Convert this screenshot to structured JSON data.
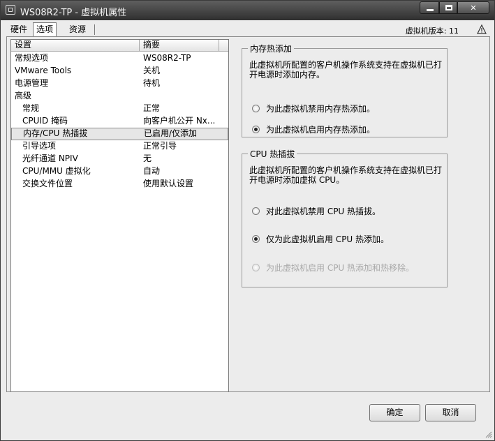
{
  "window": {
    "title": "WS08R2-TP - 虚拟机属性"
  },
  "tabs": [
    {
      "label": "硬件"
    },
    {
      "label": "选项"
    },
    {
      "label": "资源"
    }
  ],
  "version_label": "虚拟机版本: 11",
  "list": {
    "headers": {
      "setting": "设置",
      "summary": "摘要"
    },
    "rows": [
      {
        "name": "常规选项",
        "value": "WS08R2-TP"
      },
      {
        "name": "VMware Tools",
        "value": "关机"
      },
      {
        "name": "电源管理",
        "value": "待机"
      },
      {
        "name": "高级",
        "value": ""
      },
      {
        "name": "常规",
        "value": "正常"
      },
      {
        "name": "CPUID 掩码",
        "value": "向客户机公开 Nx..."
      },
      {
        "name": "内存/CPU 热插拔",
        "value": "已启用/仅添加"
      },
      {
        "name": "引导选项",
        "value": "正常引导"
      },
      {
        "name": "光纤通道 NPIV",
        "value": "无"
      },
      {
        "name": "CPU/MMU 虚拟化",
        "value": "自动"
      },
      {
        "name": "交换文件位置",
        "value": "使用默认设置"
      }
    ]
  },
  "memory_group": {
    "title": "内存热添加",
    "desc": "此虚拟机所配置的客户机操作系统支持在虚拟机已打开电源时添加内存。",
    "options": [
      {
        "label": "为此虚拟机禁用内存热添加。",
        "selected": false,
        "disabled": false
      },
      {
        "label": "为此虚拟机启用内存热添加。",
        "selected": true,
        "disabled": false
      }
    ]
  },
  "cpu_group": {
    "title": "CPU 热插拔",
    "desc": "此虚拟机所配置的客户机操作系统支持在虚拟机已打开电源时添加虚拟 CPU。",
    "options": [
      {
        "label": "对此虚拟机禁用 CPU 热插拔。",
        "selected": false,
        "disabled": false
      },
      {
        "label": "仅为此虚拟机启用 CPU 热添加。",
        "selected": true,
        "disabled": false
      },
      {
        "label": "为此虚拟机启用 CPU 热添加和热移除。",
        "selected": false,
        "disabled": true
      }
    ]
  },
  "buttons": {
    "ok": "确定",
    "cancel": "取消"
  }
}
